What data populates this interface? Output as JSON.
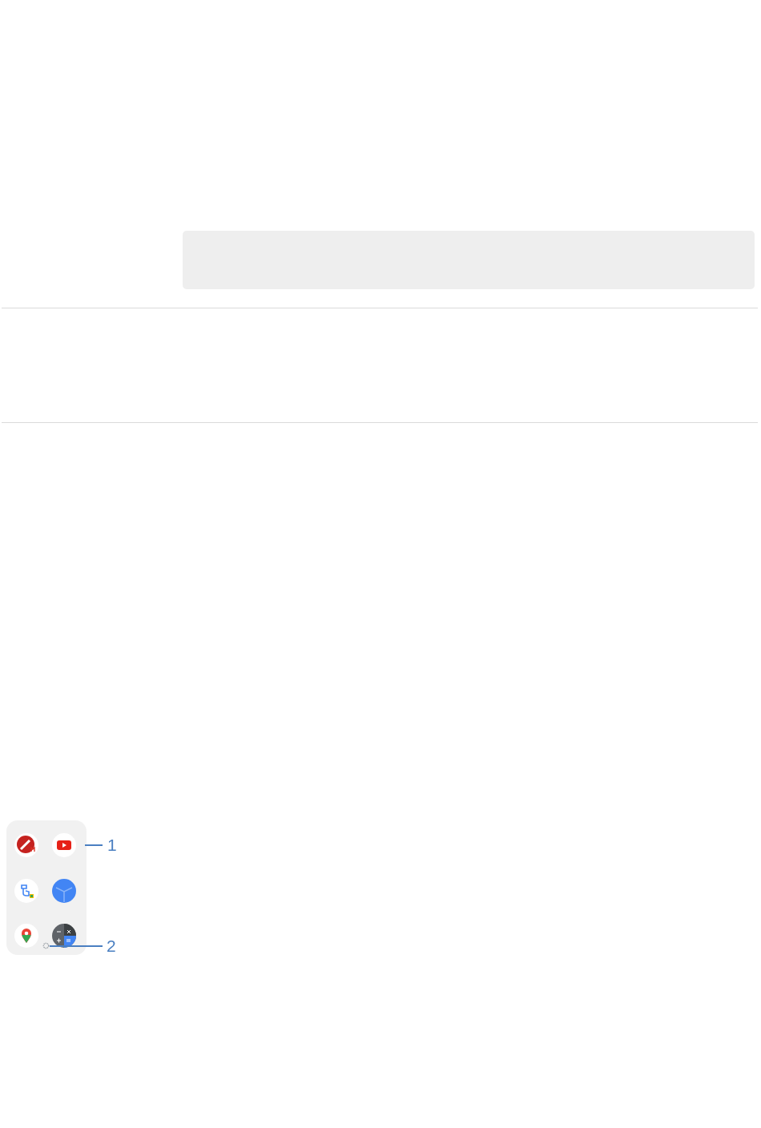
{
  "figure": {
    "callouts": [
      {
        "label": "1"
      },
      {
        "label": "2"
      }
    ]
  }
}
